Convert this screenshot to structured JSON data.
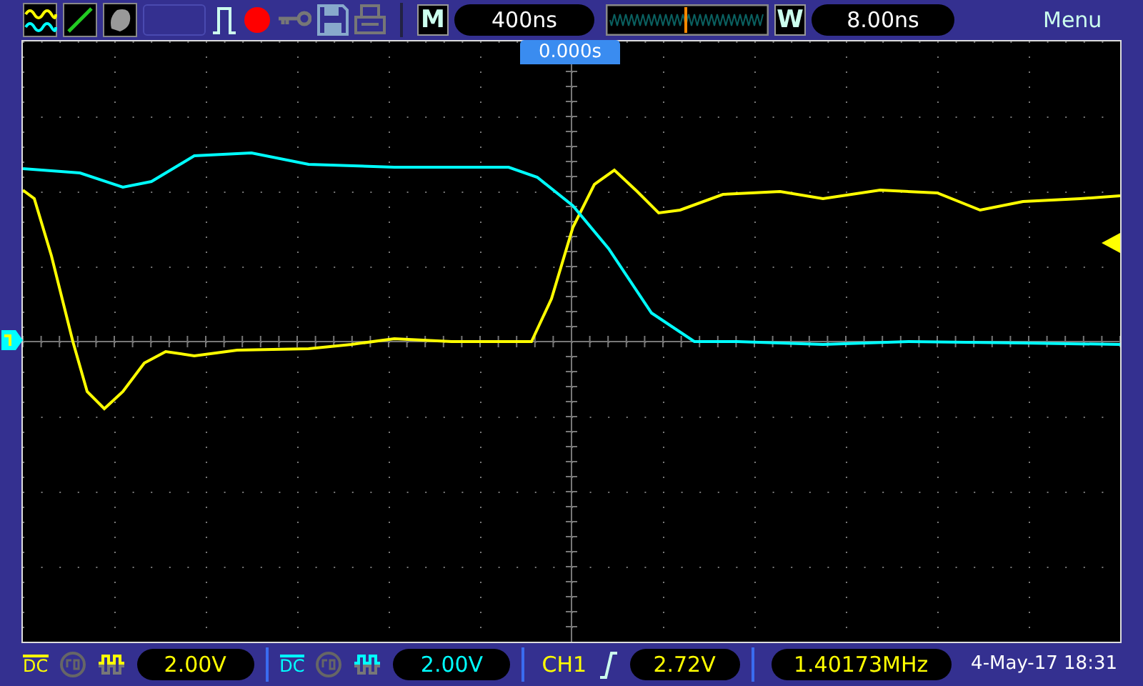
{
  "top_bar": {
    "timebase": {
      "label": "M",
      "value": "400ns"
    },
    "window": {
      "label": "W",
      "value": "8.00ns"
    },
    "menu": "Menu",
    "running": true
  },
  "trigger_time": "0.000s",
  "channels": [
    {
      "color": "#ffff00",
      "coupling": "DC",
      "scale": "2.00V"
    },
    {
      "color": "#00ffff",
      "coupling": "DC",
      "scale": "2.00V"
    }
  ],
  "trigger": {
    "source": "CH1",
    "level": "2.72V"
  },
  "frequency": "1.40173MHz",
  "datetime": "4-May-17 18:31"
}
